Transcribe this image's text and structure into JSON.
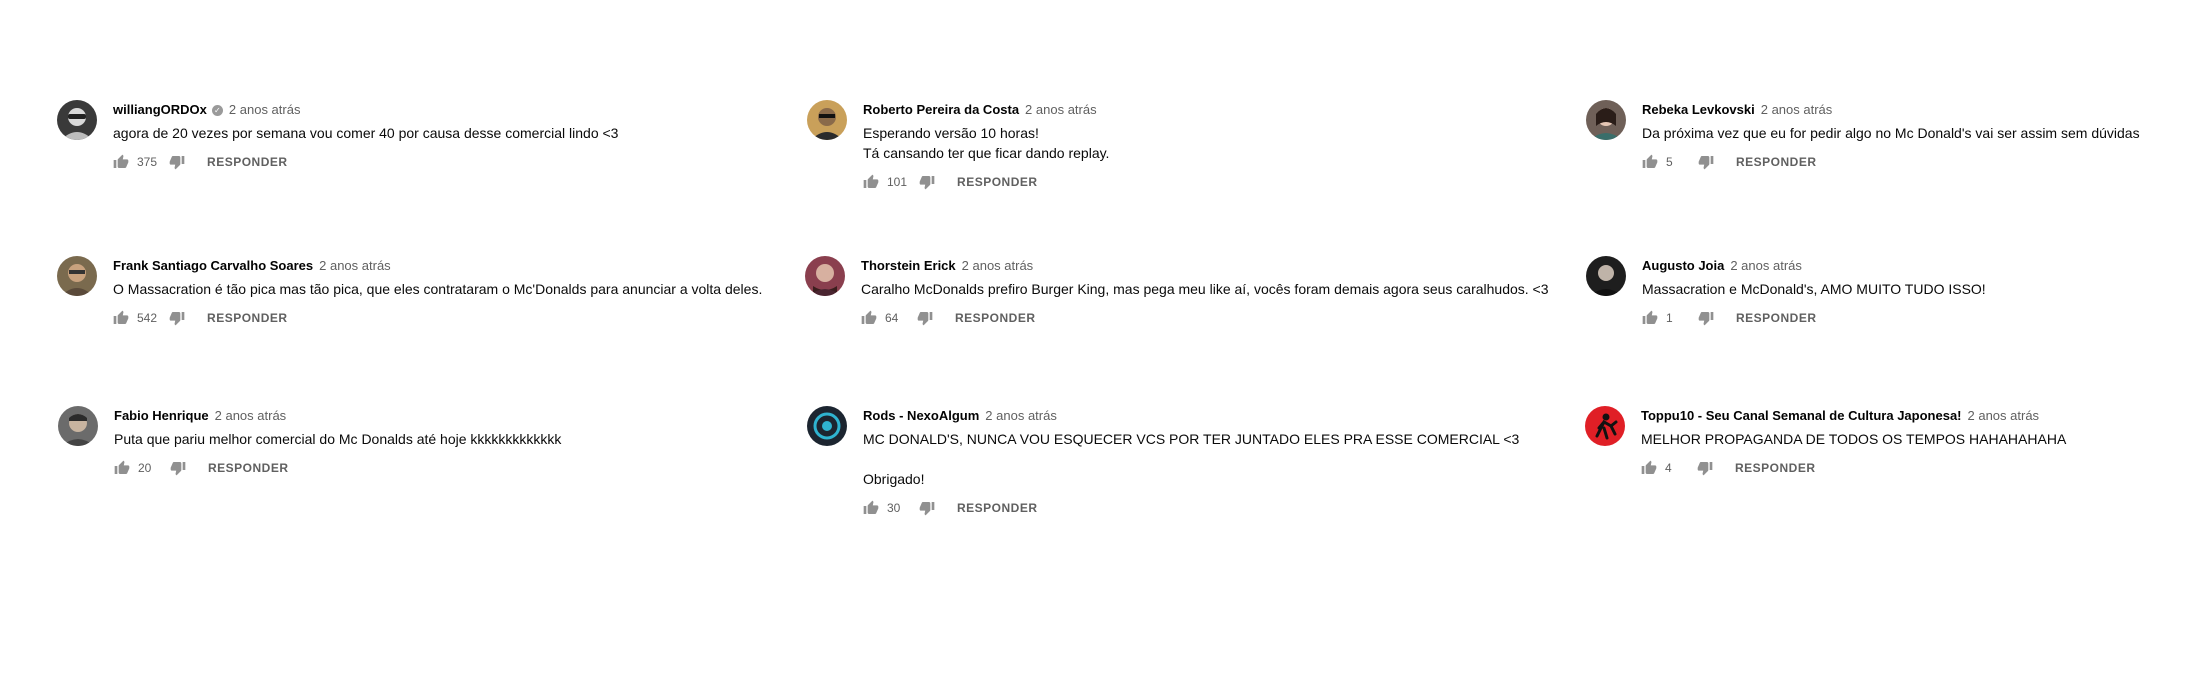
{
  "comments": [
    {
      "author": "williangORDOx",
      "verified": true,
      "time": "2 anos atrás",
      "lines": [
        "agora de 20 vezes por semana vou comer 40 por causa desse comercial lindo <3"
      ],
      "likes": "375",
      "reply_label": "RESPONDER",
      "avatar_color": "#3a3a3a"
    },
    {
      "author": "Roberto Pereira da Costa",
      "time": "2 anos atrás",
      "lines": [
        "Esperando versão 10 horas!",
        "Tá cansando ter que ficar dando replay."
      ],
      "likes": "101",
      "reply_label": "RESPONDER",
      "avatar_color": "#c9a05a"
    },
    {
      "author": "Rebeka Levkovski",
      "time": "2 anos atrás",
      "lines": [
        "Da próxima vez que eu for pedir algo no Mc Donald's vai ser assim sem dúvidas"
      ],
      "likes": "5",
      "reply_label": "RESPONDER",
      "avatar_color": "#6f6058"
    },
    {
      "author": "Frank Santiago Carvalho Soares",
      "time": "2 anos atrás",
      "lines": [
        "O Massacration é tão pica mas tão pica, que eles contrataram o Mc'Donalds para anunciar a volta deles."
      ],
      "likes": "542",
      "reply_label": "RESPONDER",
      "avatar_color": "#7a6a4e"
    },
    {
      "author": "Thorstein Erick",
      "time": "2 anos atrás",
      "lines": [
        "Caralho McDonalds prefiro Burger King, mas pega meu like aí, vocês foram demais agora seus caralhudos. <3"
      ],
      "likes": "64",
      "reply_label": "RESPONDER",
      "avatar_color": "#8a3f4e"
    },
    {
      "author": "Augusto Joia",
      "time": "2 anos atrás",
      "lines": [
        "Massacration e McDonald's, AMO MUITO TUDO ISSO!"
      ],
      "likes": "1",
      "reply_label": "RESPONDER",
      "avatar_color": "#1e1e1e"
    },
    {
      "author": "Fabio Henrique",
      "time": "2 anos atrás",
      "lines": [
        "Puta que pariu melhor comercial do Mc Donalds até hoje kkkkkkkkkkkkk"
      ],
      "likes": "20",
      "reply_label": "RESPONDER",
      "avatar_color": "#6b6b6b"
    },
    {
      "author": "Rods - NexoAlgum",
      "time": "2 anos atrás",
      "lines": [
        "MC DONALD'S, NUNCA VOU ESQUECER VCS POR TER JUNTADO ELES PRA ESSE COMERCIAL <3",
        "",
        "Obrigado!"
      ],
      "likes": "30",
      "reply_label": "RESPONDER",
      "avatar_color": "#1c2530"
    },
    {
      "author": "Toppu10 - Seu Canal Semanal de Cultura Japonesa!",
      "time": "2 anos atrás",
      "lines": [
        "MELHOR PROPAGANDA DE TODOS OS TEMPOS HAHAHAHAHA"
      ],
      "likes": "4",
      "reply_label": "RESPONDER",
      "avatar_color": "#e01f26"
    }
  ],
  "icons": {
    "like": "thumb-up-icon",
    "dislike": "thumb-down-icon",
    "verified": "check-circle-icon"
  }
}
